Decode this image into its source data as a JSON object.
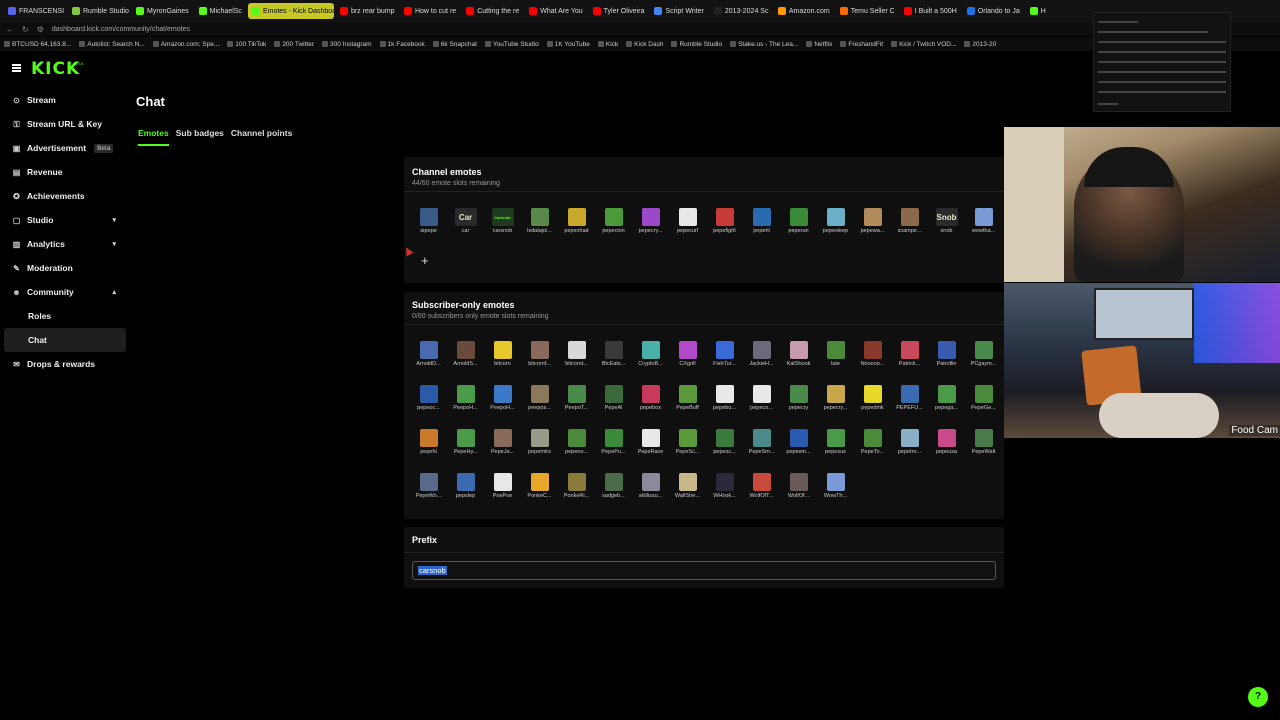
{
  "browser": {
    "tabs": [
      {
        "label": "FRANSCENSI",
        "color": "#5865f2"
      },
      {
        "label": "Rumble Studio",
        "color": "#85c742"
      },
      {
        "label": "MyronGaines",
        "color": "#53fc18"
      },
      {
        "label": "MichaelSc",
        "color": "#53fc18"
      },
      {
        "label": "Emotes - Kick Dashboard",
        "color": "#53fc18",
        "active": true
      },
      {
        "label": "brz rear bump",
        "color": "#ff0000"
      },
      {
        "label": "How to cut re",
        "color": "#ff0000"
      },
      {
        "label": "Cutting the re",
        "color": "#ff0000"
      },
      {
        "label": "What Are You",
        "color": "#ff0000"
      },
      {
        "label": "Tyler Oliveira",
        "color": "#ff0000"
      },
      {
        "label": "Script Writer",
        "color": "#4285f4"
      },
      {
        "label": "2013-2024 Sc",
        "color": "#222222"
      },
      {
        "label": "Amazon.com",
        "color": "#ff9900"
      },
      {
        "label": "Temu Seller C",
        "color": "#ff6a00"
      },
      {
        "label": "I Built a 500H",
        "color": "#ff0000"
      },
      {
        "label": "Orlando to Ja",
        "color": "#1a73e8"
      },
      {
        "label": "H",
        "color": "#53fc18"
      }
    ],
    "url": "dashboard.kick.com/community/chat/emotes",
    "bookmarks": [
      "BTCUSD 64,163.8...",
      "Autolist: Search N...",
      "Amazon.com: Spe...",
      "100 TikTok",
      "200 Twitter",
      "300 Instagram",
      "1k Facebook",
      "6k Snapchat",
      "YouTube Studio",
      "1K YouTube",
      "Kick",
      "Kick Dash",
      "Rumble Studio",
      "Stake.us - The Lea...",
      "Netflix",
      "FreshandFit",
      "Kick / Twitch VOD...",
      "2013-20"
    ]
  },
  "header": {
    "logo": "KICK",
    "logo_sup": "BETA"
  },
  "sidebar": {
    "items": [
      {
        "label": "Stream",
        "icon": "broadcast-icon",
        "glyph": "⊙"
      },
      {
        "label": "Stream URL & Key",
        "icon": "key-icon",
        "glyph": "⚿"
      },
      {
        "label": "Advertisement",
        "icon": "ad-icon",
        "glyph": "▣",
        "badge": "Beta"
      },
      {
        "label": "Revenue",
        "icon": "revenue-icon",
        "glyph": "▤"
      },
      {
        "label": "Achievements",
        "icon": "trophy-icon",
        "glyph": "✪"
      },
      {
        "label": "Studio",
        "icon": "studio-icon",
        "glyph": "▢",
        "chevron": "▾"
      },
      {
        "label": "Analytics",
        "icon": "analytics-icon",
        "glyph": "▥",
        "chevron": "▾"
      },
      {
        "label": "Moderation",
        "icon": "wrench-icon",
        "glyph": "✎"
      },
      {
        "label": "Community",
        "icon": "community-icon",
        "glyph": "☻",
        "chevron": "▴"
      },
      {
        "label": "Roles",
        "sub": true
      },
      {
        "label": "Chat",
        "sub": true,
        "active": true
      },
      {
        "label": "Drops & rewards",
        "icon": "gift-icon",
        "glyph": "✉"
      }
    ]
  },
  "page": {
    "title": "Chat",
    "tabs": [
      "Emotes",
      "Sub badges",
      "Channel points"
    ],
    "active_tab": "Emotes"
  },
  "channel_emotes": {
    "title": "Channel emotes",
    "remaining": "44/60 emote slots remaining",
    "add_label": "+",
    "items": [
      {
        "name": "aipepe",
        "color": "#3a5a8a"
      },
      {
        "name": "car",
        "color": "#2a2a2a",
        "text": "Car"
      },
      {
        "name": "carsnob",
        "color": "#1f3b1f",
        "text": "Carsnob"
      },
      {
        "name": "lsdatajoi...",
        "color": "#5a8a4a"
      },
      {
        "name": "pepechad",
        "color": "#c9a82a"
      },
      {
        "name": "pepecoin",
        "color": "#4a9a3a"
      },
      {
        "name": "pepecry...",
        "color": "#9a4ac8"
      },
      {
        "name": "pepecurl",
        "color": "#e8e8e8"
      },
      {
        "name": "pepefight",
        "color": "#c83a3a"
      },
      {
        "name": "pepehl",
        "color": "#2a6ab0"
      },
      {
        "name": "peperun",
        "color": "#3a8a3a"
      },
      {
        "name": "pepesleep",
        "color": "#6ab0c8"
      },
      {
        "name": "pepewa...",
        "color": "#b08a5a"
      },
      {
        "name": "scampe...",
        "color": "#8a6a4a"
      },
      {
        "name": "snob",
        "color": "#2a2a2a",
        "text": "Snob"
      },
      {
        "name": "wowtha...",
        "color": "#7a9ad8"
      }
    ]
  },
  "subscriber_emotes": {
    "title": "Subscriber-only emotes",
    "remaining": "0/60 subscribers only emote slots remaining",
    "items": [
      {
        "name": "ArnoldD...",
        "color": "#4a6ab0"
      },
      {
        "name": "ArnoldS...",
        "color": "#6a4a3a"
      },
      {
        "name": "bitcorn",
        "color": "#e8c82a"
      },
      {
        "name": "bitcornf...",
        "color": "#8a6a5a"
      },
      {
        "name": "bitcornt...",
        "color": "#d8d8d8"
      },
      {
        "name": "BtcEats...",
        "color": "#3a3a3a"
      },
      {
        "name": "CryptoB...",
        "color": "#4ab0a8"
      },
      {
        "name": "CXgrill",
        "color": "#b04ac8"
      },
      {
        "name": "FishTur...",
        "color": "#3a6ad8"
      },
      {
        "name": "JackieH...",
        "color": "#6a6a7a"
      },
      {
        "name": "KatShook",
        "color": "#c89ab0"
      },
      {
        "name": "late",
        "color": "#4a8a3a"
      },
      {
        "name": "Nooooo...",
        "color": "#8a3a2a"
      },
      {
        "name": "Patrick...",
        "color": "#c84a5a"
      },
      {
        "name": "Patrollin",
        "color": "#3a5ab0"
      },
      {
        "name": "PCgaym...",
        "color": "#4a8a4a"
      },
      {
        "name": "pepeoc...",
        "color": "#2a5aa8"
      },
      {
        "name": "PeepoH...",
        "color": "#4a9a4a"
      },
      {
        "name": "PeepoH...",
        "color": "#3a7ac8"
      },
      {
        "name": "peepos...",
        "color": "#8a7a5a"
      },
      {
        "name": "PeepoT...",
        "color": "#4a8a4a"
      },
      {
        "name": "PepeAl",
        "color": "#3a6a3a"
      },
      {
        "name": "pepebox",
        "color": "#c83a5a"
      },
      {
        "name": "PepeBuff",
        "color": "#5a9a3a"
      },
      {
        "name": "pepebu...",
        "color": "#e8e8e8"
      },
      {
        "name": "pepeco...",
        "color": "#e8e8e8"
      },
      {
        "name": "pepecry",
        "color": "#4a8a4a"
      },
      {
        "name": "pepecry...",
        "color": "#c8a84a"
      },
      {
        "name": "pepedmk",
        "color": "#e8d82a"
      },
      {
        "name": "PEPEFU...",
        "color": "#3a6ab0"
      },
      {
        "name": "pepega...",
        "color": "#4a9a4a"
      },
      {
        "name": "PepeGe...",
        "color": "#4a8a3a"
      },
      {
        "name": "pepehl",
        "color": "#c87a2a"
      },
      {
        "name": "PepeHy...",
        "color": "#4a9a4a"
      },
      {
        "name": "PepeJa...",
        "color": "#8a6a5a"
      },
      {
        "name": "pepemtrx",
        "color": "#9a9a8a"
      },
      {
        "name": "pepeno...",
        "color": "#4a8a3a"
      },
      {
        "name": "PepePu...",
        "color": "#3a8a3a"
      },
      {
        "name": "PepeRace",
        "color": "#e8e8e8"
      },
      {
        "name": "PepeSc...",
        "color": "#5a9a3a"
      },
      {
        "name": "pepesc...",
        "color": "#3a7a3a"
      },
      {
        "name": "PepeSm...",
        "color": "#4a8a8a"
      },
      {
        "name": "pepesm...",
        "color": "#2a5ab0"
      },
      {
        "name": "pepesus",
        "color": "#4a9a4a"
      },
      {
        "name": "PepeTo...",
        "color": "#4a8a3a"
      },
      {
        "name": "pepetro...",
        "color": "#8ab0c8"
      },
      {
        "name": "pepeusa",
        "color": "#c84a8a"
      },
      {
        "name": "PepeWalt",
        "color": "#4a7a4a"
      },
      {
        "name": "PepeWo...",
        "color": "#5a6a8a"
      },
      {
        "name": "pepslep",
        "color": "#3a6ab0"
      },
      {
        "name": "PoePoe",
        "color": "#e8e8e8"
      },
      {
        "name": "PonkeC...",
        "color": "#e8a82a"
      },
      {
        "name": "PonkeRi...",
        "color": "#8a7a3a"
      },
      {
        "name": "sadgeb...",
        "color": "#4a6a4a"
      },
      {
        "name": "skillissu...",
        "color": "#8a8a9a"
      },
      {
        "name": "WallStre...",
        "color": "#c8b88a"
      },
      {
        "name": "WHook...",
        "color": "#2a2a3a"
      },
      {
        "name": "WolfOfT...",
        "color": "#c84a3a"
      },
      {
        "name": "WolfOf...",
        "color": "#6a5a5a"
      },
      {
        "name": "WowTh...",
        "color": "#7a9ad8"
      }
    ]
  },
  "prefix": {
    "title": "Prefix",
    "value": "carsnob"
  },
  "webcam": {
    "label": "Food Cam"
  },
  "colors": {
    "accent": "#53fc18",
    "panel": "#0f0f0f",
    "selection": "#2f67c8"
  }
}
